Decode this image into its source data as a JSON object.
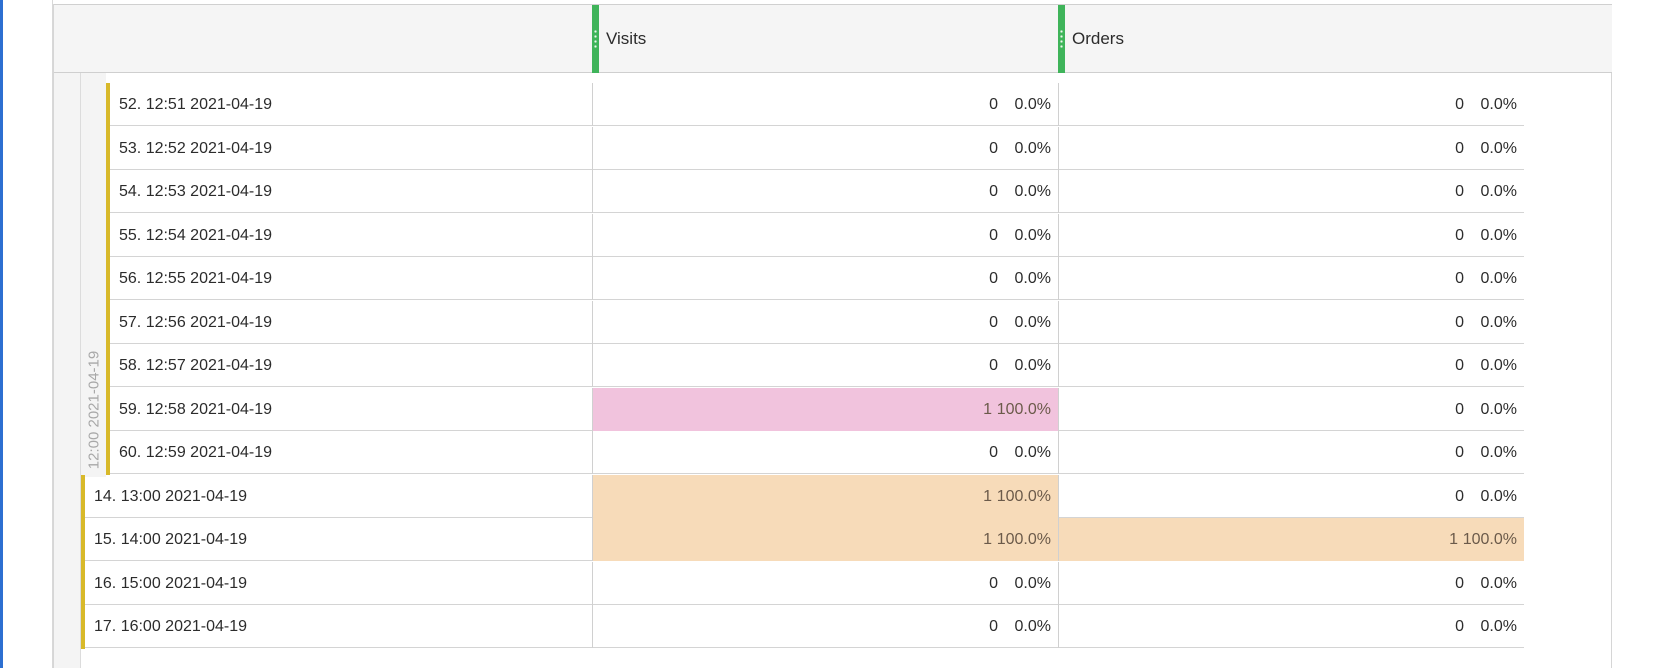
{
  "columns": [
    {
      "label": "Visits",
      "accent": "#3fb45a"
    },
    {
      "label": "Orders",
      "accent": "#3fb45a"
    }
  ],
  "group_label": "12:00 2021-04-19",
  "colors": {
    "highlight_pink": "#f1c3dd",
    "highlight_orange": "#f7dbb9",
    "row_bar": "#d8b92a",
    "left_accent": "#2d6fd1"
  },
  "rows": [
    {
      "name": "52. 12:51 2021-04-19",
      "level": 2,
      "visits": "0",
      "visits_pct": "0.0%",
      "orders": "0",
      "orders_pct": "0.0%",
      "visits_hl": "",
      "orders_hl": ""
    },
    {
      "name": "53. 12:52 2021-04-19",
      "level": 2,
      "visits": "0",
      "visits_pct": "0.0%",
      "orders": "0",
      "orders_pct": "0.0%",
      "visits_hl": "",
      "orders_hl": ""
    },
    {
      "name": "54. 12:53 2021-04-19",
      "level": 2,
      "visits": "0",
      "visits_pct": "0.0%",
      "orders": "0",
      "orders_pct": "0.0%",
      "visits_hl": "",
      "orders_hl": ""
    },
    {
      "name": "55. 12:54 2021-04-19",
      "level": 2,
      "visits": "0",
      "visits_pct": "0.0%",
      "orders": "0",
      "orders_pct": "0.0%",
      "visits_hl": "",
      "orders_hl": ""
    },
    {
      "name": "56. 12:55 2021-04-19",
      "level": 2,
      "visits": "0",
      "visits_pct": "0.0%",
      "orders": "0",
      "orders_pct": "0.0%",
      "visits_hl": "",
      "orders_hl": ""
    },
    {
      "name": "57. 12:56 2021-04-19",
      "level": 2,
      "visits": "0",
      "visits_pct": "0.0%",
      "orders": "0",
      "orders_pct": "0.0%",
      "visits_hl": "",
      "orders_hl": ""
    },
    {
      "name": "58. 12:57 2021-04-19",
      "level": 2,
      "visits": "0",
      "visits_pct": "0.0%",
      "orders": "0",
      "orders_pct": "0.0%",
      "visits_hl": "",
      "orders_hl": ""
    },
    {
      "name": "59. 12:58 2021-04-19",
      "level": 2,
      "visits": "1",
      "visits_pct": "100.0%",
      "orders": "0",
      "orders_pct": "0.0%",
      "visits_hl": "pink",
      "orders_hl": ""
    },
    {
      "name": "60. 12:59 2021-04-19",
      "level": 2,
      "visits": "0",
      "visits_pct": "0.0%",
      "orders": "0",
      "orders_pct": "0.0%",
      "visits_hl": "",
      "orders_hl": ""
    },
    {
      "name": "14. 13:00 2021-04-19",
      "level": 1,
      "visits": "1",
      "visits_pct": "100.0%",
      "orders": "0",
      "orders_pct": "0.0%",
      "visits_hl": "orange",
      "orders_hl": ""
    },
    {
      "name": "15. 14:00 2021-04-19",
      "level": 1,
      "visits": "1",
      "visits_pct": "100.0%",
      "orders": "1",
      "orders_pct": "100.0%",
      "visits_hl": "orange",
      "orders_hl": "orange"
    },
    {
      "name": "16. 15:00 2021-04-19",
      "level": 1,
      "visits": "0",
      "visits_pct": "0.0%",
      "orders": "0",
      "orders_pct": "0.0%",
      "visits_hl": "",
      "orders_hl": ""
    },
    {
      "name": "17. 16:00 2021-04-19",
      "level": 1,
      "visits": "0",
      "visits_pct": "0.0%",
      "orders": "0",
      "orders_pct": "0.0%",
      "visits_hl": "",
      "orders_hl": ""
    }
  ]
}
